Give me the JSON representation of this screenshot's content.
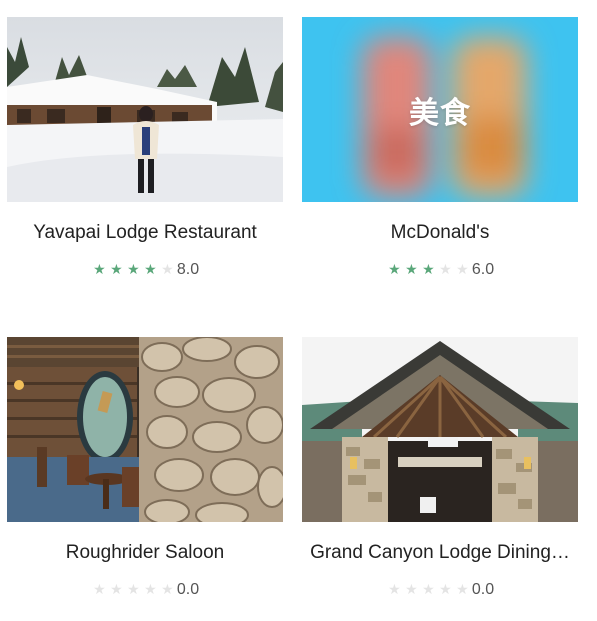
{
  "colors": {
    "star_filled": "#5aa77a",
    "star_empty": "#e4e4e4"
  },
  "restaurants": [
    {
      "name": "Yavapai Lodge Restaurant",
      "score": "8.0",
      "stars_filled": 4,
      "image": "snowy-lodge-photo"
    },
    {
      "name": "McDonald's",
      "score": "6.0",
      "stars_filled": 3,
      "image": "food-placeholder",
      "image_text": "美食"
    },
    {
      "name": "Roughrider Saloon",
      "score": "0.0",
      "stars_filled": 0,
      "image": "saloon-interior-photo"
    },
    {
      "name": "Grand Canyon Lodge Dining…",
      "score": "0.0",
      "stars_filled": 0,
      "image": "stone-lodge-photo"
    }
  ]
}
